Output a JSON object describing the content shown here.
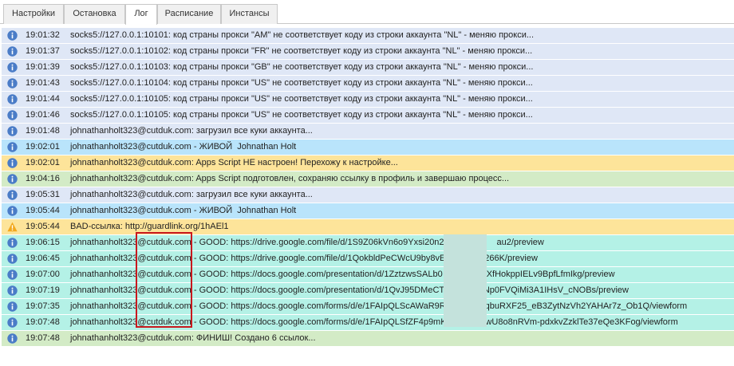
{
  "tabs": [
    {
      "label": "Настройки"
    },
    {
      "label": "Остановка"
    },
    {
      "label": "Лог"
    },
    {
      "label": "Расписание"
    },
    {
      "label": "Инстансы"
    }
  ],
  "active_tab": "Лог",
  "colors": {
    "info_row": "#dfe7f6",
    "account_row": "#b9e4fb",
    "warning_row": "#fde49a",
    "success_row": "#d3ebc6",
    "link_row": "#b4f1e6",
    "info_icon": "#4a7cc7",
    "warning_icon": "#f2a81d",
    "highlight_border": "#c8191e"
  },
  "log": [
    {
      "icon": "info-icon",
      "type": "info",
      "time": "19:01:32",
      "message": "socks5://127.0.0.1:10101: код страны прокси \"AM\" не соответствует коду из строки аккаунта \"NL\" - меняю прокси..."
    },
    {
      "icon": "info-icon",
      "type": "info",
      "time": "19:01:37",
      "message": "socks5://127.0.0.1:10102: код страны прокси \"FR\" не соответствует коду из строки аккаунта \"NL\" - меняю прокси..."
    },
    {
      "icon": "info-icon",
      "type": "info",
      "time": "19:01:39",
      "message": "socks5://127.0.0.1:10103: код страны прокси \"GB\" не соответствует коду из строки аккаунта \"NL\" - меняю прокси..."
    },
    {
      "icon": "info-icon",
      "type": "info",
      "time": "19:01:43",
      "message": "socks5://127.0.0.1:10104: код страны прокси \"US\" не соответствует коду из строки аккаунта \"NL\" - меняю прокси..."
    },
    {
      "icon": "info-icon",
      "type": "info",
      "time": "19:01:44",
      "message": "socks5://127.0.0.1:10105: код страны прокси \"US\" не соответствует коду из строки аккаунта \"NL\" - меняю прокси..."
    },
    {
      "icon": "info-icon",
      "type": "info",
      "time": "19:01:46",
      "message": "socks5://127.0.0.1:10105: код страны прокси \"US\" не соответствует коду из строки аккаунта \"NL\" - меняю прокси..."
    },
    {
      "icon": "info-icon",
      "type": "info",
      "time": "19:01:48",
      "message": "johnathanholt323@cutduk.com: загрузил все куки аккаунта..."
    },
    {
      "icon": "info-icon",
      "type": "account",
      "time": "19:02:01",
      "message": "johnathanholt323@cutduk.com - ЖИВОЙ  Johnathan Holt"
    },
    {
      "icon": "info-icon",
      "type": "warning",
      "time": "19:02:01",
      "message": "johnathanholt323@cutduk.com: Apps Script НЕ настроен! Перехожу к настройке..."
    },
    {
      "icon": "info-icon",
      "type": "success",
      "time": "19:04:16",
      "message": "johnathanholt323@cutduk.com: Apps Script подготовлен, сохраняю ссылку в профиль и завершаю процесс..."
    },
    {
      "icon": "info-icon",
      "type": "info",
      "time": "19:05:31",
      "message": "johnathanholt323@cutduk.com: загрузил все куки аккаунта..."
    },
    {
      "icon": "info-icon",
      "type": "account",
      "time": "19:05:44",
      "message": "johnathanholt323@cutduk.com - ЖИВОЙ  Johnathan Holt"
    },
    {
      "icon": "warning-icon",
      "type": "warning",
      "time": "19:05:44",
      "message": "BAD-ссылка: http://guardlink.org/1hAEl1"
    },
    {
      "icon": "info-icon",
      "type": "link",
      "time": "19:06:15",
      "message": "johnathanholt323@cutduk.com - GOOD: https://drive.google.com/file/d/1S9Z06kVn6o9Yxsi20n2xv1                au2/preview"
    },
    {
      "icon": "info-icon",
      "type": "link",
      "time": "19:06:45",
      "message": "johnathanholt323@cutduk.com - GOOD: https://drive.google.com/file/d/1QokbldPeCWcU9by8vE                266K/preview"
    },
    {
      "icon": "info-icon",
      "type": "link",
      "time": "19:07:00",
      "message": "johnathanholt323@cutduk.com - GOOD: https://docs.google.com/presentation/d/1ZztzwsSALb0                nXfHokppIELv9BpfLfmIkg/preview"
    },
    {
      "icon": "info-icon",
      "type": "link",
      "time": "19:07:19",
      "message": "johnathanholt323@cutduk.com - GOOD: https://docs.google.com/presentation/d/1QvJ95DMeCT                Np0FVQiMi3A1IHsV_cNOBs/preview"
    },
    {
      "icon": "info-icon",
      "type": "link",
      "time": "19:07:35",
      "message": "johnathanholt323@cutduk.com - GOOD: https://docs.google.com/forms/d/e/1FAIpQLScAWaR9R                qbuRXF25_eB3ZytNzVh2YAHAr7z_Ob1Q/viewform"
    },
    {
      "icon": "info-icon",
      "type": "link",
      "time": "19:07:48",
      "message": "johnathanholt323@cutduk.com - GOOD: https://docs.google.com/forms/d/e/1FAIpQLSfZF4p9mK                wU8o8nRVm-pdxkvZzklTe37eQe3KFog/viewform"
    },
    {
      "icon": "info-icon",
      "type": "success",
      "time": "19:07:48",
      "message": "johnathanholt323@cutduk.com: ФИНИШ! Создано 6 ссылок..."
    }
  ]
}
